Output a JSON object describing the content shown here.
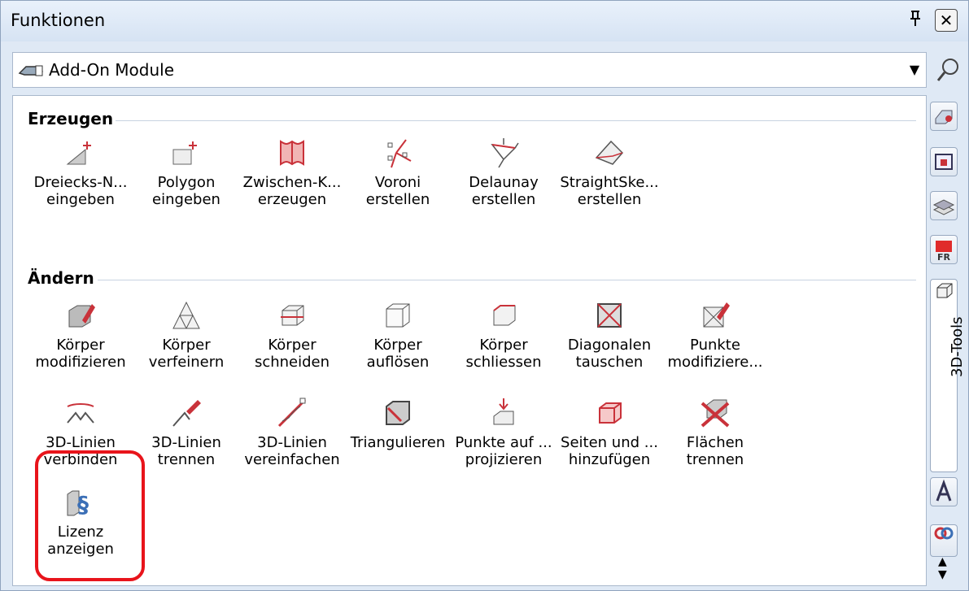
{
  "window": {
    "title": "Funktionen",
    "pin": "4",
    "close": "✕"
  },
  "combo": {
    "value": "Add-On Module"
  },
  "sections": [
    {
      "title": "Erzeugen"
    },
    {
      "title": "Ändern"
    }
  ],
  "erzeugen": [
    {
      "label": "Dreiecks-N...\neingeben"
    },
    {
      "label": "Polygon\neingeben"
    },
    {
      "label": "Zwischen-K...\nerzeugen"
    },
    {
      "label": "Voroni\nerstellen"
    },
    {
      "label": "Delaunay\nerstellen"
    },
    {
      "label": "StraightSke...\nerstellen"
    }
  ],
  "aendern_row1": [
    {
      "label": "Körper\nmodifizieren"
    },
    {
      "label": "Körper\nverfeinern"
    },
    {
      "label": "Körper\nschneiden"
    },
    {
      "label": "Körper\nauflösen"
    },
    {
      "label": "Körper\nschliessen"
    },
    {
      "label": "Diagonalen\ntauschen"
    },
    {
      "label": "Punkte\nmodifiziere..."
    }
  ],
  "aendern_row2": [
    {
      "label": "3D-Linien\nverbinden"
    },
    {
      "label": "3D-Linien\ntrennen"
    },
    {
      "label": "3D-Linien\nvereinfachen"
    },
    {
      "label": "Triangulieren"
    },
    {
      "label": "Punkte auf ...\nprojizieren"
    },
    {
      "label": "Seiten und ...\nhinzufügen"
    },
    {
      "label": "Flächen\ntrennen"
    }
  ],
  "aendern_row3": [
    {
      "label": "Lizenz\nanzeigen"
    }
  ],
  "side_tab": {
    "label": "3D-Tools"
  },
  "colors": {
    "accent_red": "#c9323a",
    "highlight": "#e8141b"
  }
}
